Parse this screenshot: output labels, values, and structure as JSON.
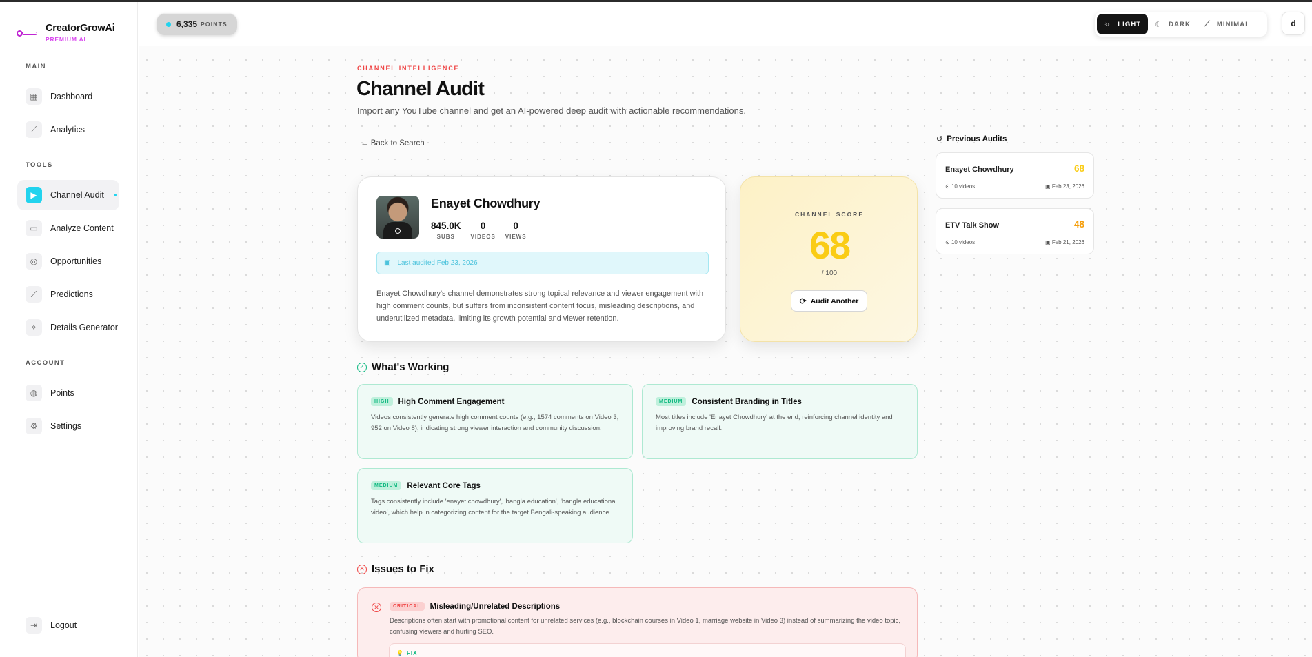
{
  "brand": {
    "name": "CreatorGrowAi",
    "tagline": "PREMIUM AI"
  },
  "sidebar": {
    "sections": {
      "main": "MAIN",
      "tools": "TOOLS",
      "account": "ACCOUNT"
    },
    "items": [
      {
        "label": "Dashboard",
        "icon": "grid-icon"
      },
      {
        "label": "Analytics",
        "icon": "chart-icon"
      },
      {
        "label": "Channel Audit",
        "icon": "video-icon",
        "active": true
      },
      {
        "label": "Analyze Content",
        "icon": "message-icon"
      },
      {
        "label": "Opportunities",
        "icon": "target-icon"
      },
      {
        "label": "Predictions",
        "icon": "trend-icon"
      },
      {
        "label": "Details Generator",
        "icon": "sparkle-icon"
      },
      {
        "label": "Points",
        "icon": "coins-icon"
      },
      {
        "label": "Settings",
        "icon": "gear-icon"
      }
    ],
    "logout": "Logout"
  },
  "topbar": {
    "points_value": "6,335",
    "points_label": "POINTS",
    "theme": {
      "light": "LIGHT",
      "dark": "DARK",
      "minimal": "MINIMAL",
      "active": "light"
    },
    "avatar_initial": "d"
  },
  "page": {
    "eyebrow": "CHANNEL INTELLIGENCE",
    "title": "Channel Audit",
    "subtitle": "Import any YouTube channel and get an AI-powered deep audit with actionable recommendations.",
    "back": "← Back to Search"
  },
  "channel": {
    "name": "Enayet Chowdhury",
    "stats": [
      {
        "value": "845.0K",
        "label": "SUBS"
      },
      {
        "value": "0",
        "label": "VIDEOS"
      },
      {
        "value": "0",
        "label": "VIEWS"
      }
    ],
    "last_audited": "Last audited Feb 23, 2026",
    "summary": "Enayet Chowdhury's channel demonstrates strong topical relevance and viewer engagement with high comment counts, but suffers from inconsistent content focus, misleading descriptions, and underutilized metadata, limiting its growth potential and viewer retention."
  },
  "score": {
    "label": "CHANNEL SCORE",
    "value": "68",
    "max": "/ 100",
    "button": "Audit Another",
    "color": "#facc15"
  },
  "previous_audits": {
    "title": "Previous Audits",
    "items": [
      {
        "name": "Enayet Chowdhury",
        "score": "68",
        "videos": "10 videos",
        "date": "Feb 23, 2026",
        "color": "#facc15"
      },
      {
        "name": "ETV Talk Show",
        "score": "48",
        "videos": "10 videos",
        "date": "Feb 21, 2026",
        "color": "#f59e0b"
      }
    ]
  },
  "working": {
    "title": "What's Working",
    "items": [
      {
        "badge": "HIGH",
        "title": "High Comment Engagement",
        "desc": "Videos consistently generate high comment counts (e.g., 1574 comments on Video 3, 952 on Video 8), indicating strong viewer interaction and community discussion."
      },
      {
        "badge": "MEDIUM",
        "title": "Consistent Branding in Titles",
        "desc": "Most titles include 'Enayet Chowdhury' at the end, reinforcing channel identity and improving brand recall."
      },
      {
        "badge": "MEDIUM",
        "title": "Relevant Core Tags",
        "desc": "Tags consistently include 'enayet chowdhury', 'bangla education', 'bangla educational video', which help in categorizing content for the target Bengali-speaking audience."
      }
    ]
  },
  "issues": {
    "title": "Issues to Fix",
    "items": [
      {
        "badge": "CRITICAL",
        "title": "Misleading/Unrelated Descriptions",
        "desc": "Descriptions often start with promotional content for unrelated services (e.g., blockchain courses in Video 1, marriage website in Video 3) instead of summarizing the video topic, confusing viewers and hurting SEO.",
        "fix_label": "FIX"
      }
    ]
  },
  "colors": {
    "accent": "#22d3ee",
    "danger": "#ef4444",
    "success": "#10b981",
    "brand": "#d946ef"
  }
}
